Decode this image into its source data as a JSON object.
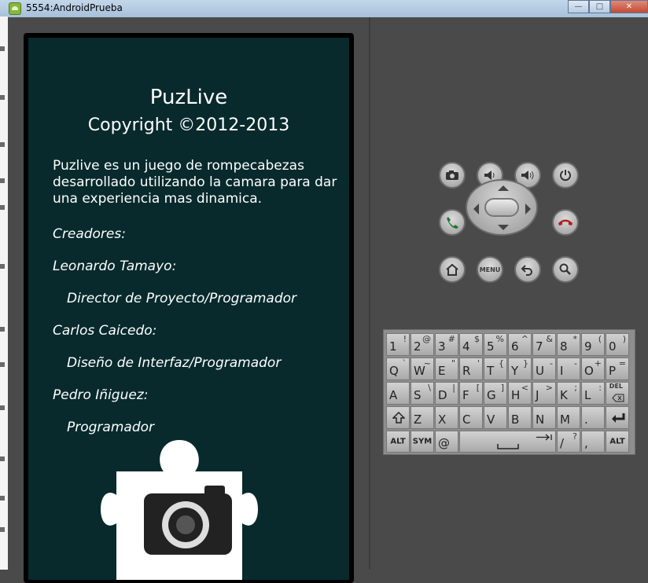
{
  "window": {
    "title": "5554:AndroidPrueba",
    "buttons": {
      "minimize": "—",
      "maximize": "□",
      "close": "✕"
    }
  },
  "app": {
    "title": "PuzLive",
    "copyright": "Copyright ©2012-2013",
    "description": "Puzlive es un juego de rompecabezas desarrollado utilizando la camara para dar una experiencia mas dinamica.",
    "credits_heading": "Creadores:",
    "credits": [
      {
        "name": "Leonardo Tamayo:",
        "role": "Director de Proyecto/Programador"
      },
      {
        "name": "Carlos Caicedo:",
        "role": "Diseño de Interfaz/Programador"
      },
      {
        "name": "Pedro Iñiguez:",
        "role": "Programador"
      }
    ]
  },
  "controls": {
    "camera": "camera-icon",
    "volume_down": "volume-down-icon",
    "volume_up": "volume-up-icon",
    "power": "power-icon",
    "call": "call-icon",
    "end_call": "end-call-icon",
    "home": "home-icon",
    "menu_label": "MENU",
    "back": "back-icon",
    "search": "search-icon"
  },
  "keyboard": {
    "rows": [
      [
        [
          "1",
          "!"
        ],
        [
          "2",
          "@"
        ],
        [
          "3",
          "#"
        ],
        [
          "4",
          "$"
        ],
        [
          "5",
          "%"
        ],
        [
          "6",
          "^"
        ],
        [
          "7",
          "&"
        ],
        [
          "8",
          "*"
        ],
        [
          "9",
          "("
        ],
        [
          "0",
          ")"
        ]
      ],
      [
        [
          "Q",
          "`"
        ],
        [
          "W",
          "~"
        ],
        [
          "E",
          "\""
        ],
        [
          "R",
          "'"
        ],
        [
          "T",
          "{"
        ],
        [
          "Y",
          "}"
        ],
        [
          "U",
          "-"
        ],
        [
          "I",
          "-"
        ],
        [
          "O",
          "+"
        ],
        [
          "P",
          "="
        ]
      ],
      [
        [
          "A",
          ""
        ],
        [
          "S",
          "\\"
        ],
        [
          "D",
          "|"
        ],
        [
          "F",
          "["
        ],
        [
          "G",
          "]"
        ],
        [
          "H",
          "<"
        ],
        [
          "J",
          ">"
        ],
        [
          "K",
          ";"
        ],
        [
          "L",
          ":"
        ]
      ],
      [
        [
          "Z",
          ""
        ],
        [
          "X",
          ""
        ],
        [
          "C",
          ""
        ],
        [
          "V",
          ""
        ],
        [
          "B",
          ""
        ],
        [
          "N",
          ""
        ],
        [
          "M",
          ""
        ],
        [
          ".",
          ""
        ]
      ]
    ],
    "del_label": "DEL",
    "alt_label": "ALT",
    "sym_label": "SYM",
    "at_label": "@",
    "slash_key": [
      "/",
      "?"
    ],
    "comma_key": [
      ",",
      ""
    ]
  }
}
